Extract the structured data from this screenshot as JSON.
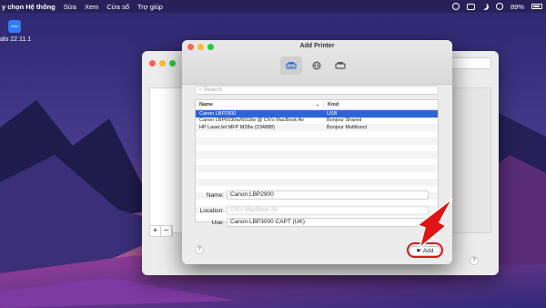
{
  "menubar": {
    "app_name": "y chọn Hệ thống",
    "items": [
      "Sửa",
      "Xem",
      "Cửa sổ",
      "Trợ giúp"
    ],
    "battery": "89%"
  },
  "desktop_icon": {
    "icon_text": "Zalo",
    "label": "alo 22.11.1"
  },
  "dialog": {
    "title": "Add Printer",
    "toolbar": [
      "default-printer-icon",
      "ip-printer-icon",
      "windows-printer-icon"
    ],
    "search_placeholder": "Search",
    "columns": {
      "name": "Name",
      "kind": "Kind"
    },
    "printers": [
      {
        "name": "Canon LBP2900",
        "kind": "USB",
        "selected": true
      },
      {
        "name": "Canon LBP6030w/6018w @ Chi's MacBook Air",
        "kind": "Bonjour Shared",
        "selected": false
      },
      {
        "name": "HP LaserJet MFP M28w (234888)",
        "kind": "Bonjour Multifunct",
        "selected": false
      }
    ],
    "fields": {
      "name_label": "Name:",
      "name_value": "Canon LBP2900",
      "location_label": "Location:",
      "location_value": "Chi's MacBook Air",
      "use_label": "Use:",
      "use_value": "Canon LBP3000 CAPT (UK)"
    },
    "help_label": "?",
    "add_label": "Add"
  },
  "background_window": {
    "help_label": "?",
    "plus": "+",
    "minus": "−"
  },
  "colors": {
    "selection": "#2d64d8",
    "highlight": "#d71a1a",
    "arrow": "#e01414"
  }
}
